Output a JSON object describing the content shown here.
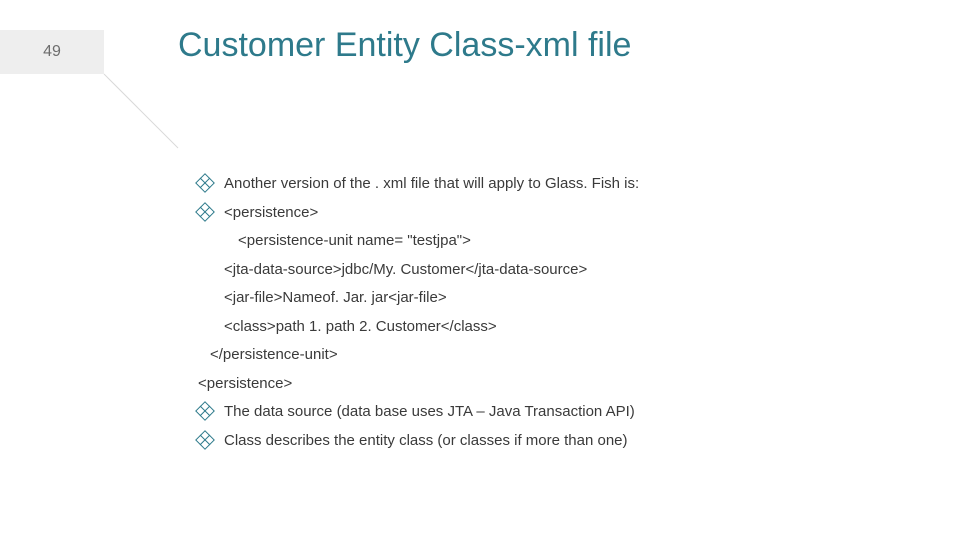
{
  "page_number": "49",
  "title": "Customer Entity Class-xml file",
  "bullets": {
    "b1": "Another version of the . xml file that will apply to Glass. Fish is:",
    "b2": "<persistence>",
    "b3": "The data source (data base uses JTA – Java Transaction API)",
    "b4": "Class describes the entity class (or classes if more than one)"
  },
  "code": {
    "l1": "<persistence-unit name= \"testjpa\">",
    "l2": "<jta-data-source>jdbc/My. Customer</jta-data-source>",
    "l3": "<jar-file>Nameof. Jar. jar<jar-file>",
    "l4": "<class>path 1. path 2. Customer</class>",
    "l5": "</persistence-unit>",
    "l6": "<persistence>"
  }
}
